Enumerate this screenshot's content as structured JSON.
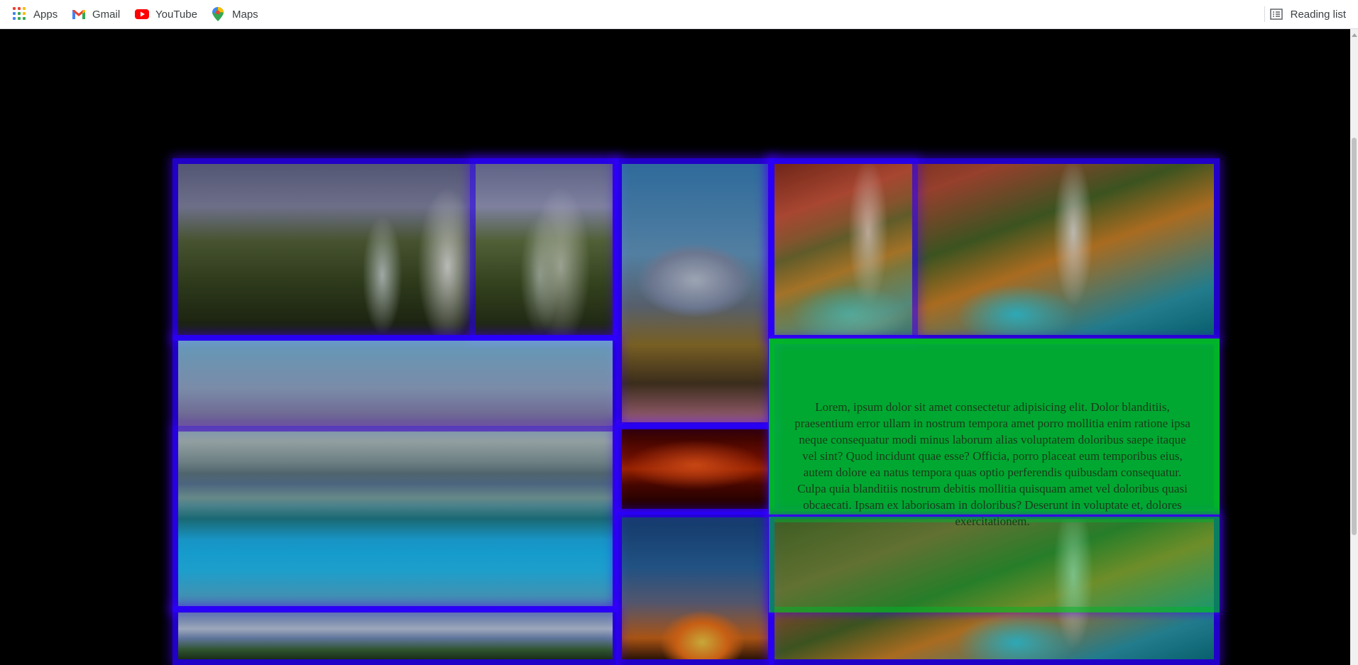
{
  "bookmarks": {
    "items": [
      {
        "label": "Apps",
        "icon": "apps-grid-icon"
      },
      {
        "label": "Gmail",
        "icon": "gmail-icon"
      },
      {
        "label": "YouTube",
        "icon": "youtube-icon"
      },
      {
        "label": "Maps",
        "icon": "maps-icon"
      }
    ],
    "reading_list": {
      "label": "Reading list",
      "icon": "reading-list-icon"
    }
  },
  "gallery": {
    "tiles": [
      {
        "name": "waterfall-hills",
        "scene": "waterfall"
      },
      {
        "name": "mountain-reflection",
        "scene": "mountain"
      },
      {
        "name": "canyon-waterfall-top",
        "scene": "canyon"
      },
      {
        "name": "mountain-lake",
        "scene": "lake"
      },
      {
        "name": "red-sea-sunset",
        "scene": "sunset-sea"
      },
      {
        "name": "cloud-sunset",
        "scene": "sky-sunset"
      },
      {
        "name": "canyon-waterfall-bottom",
        "scene": "canyon"
      },
      {
        "name": "snowy-peaks",
        "scene": "snowpeaks"
      }
    ],
    "overlay_text": "Lorem, ipsum dolor sit amet consectetur adipisicing elit. Dolor blanditiis, praesentium error ullam in nostrum tempora amet porro mollitia enim ratione ipsa neque consequatur modi minus laborum alias voluptatem doloribus saepe itaque vel sint? Quod incidunt quae esse? Officia, porro placeat eum temporibus eius, autem dolore ea natus tempora quas optio perferendis quibusdam consequatur. Culpa quia blanditiis nostrum debitis mollitia quisquam amet vel doloribus quasi obcaecati. Ipsam ex laboriosam in doloribus? Deserunt in voluptate et, dolores exercitationem."
  },
  "colors": {
    "tile_border": "#2b00ff",
    "overlay_green": "#00cd3c",
    "page_background": "#000000"
  }
}
